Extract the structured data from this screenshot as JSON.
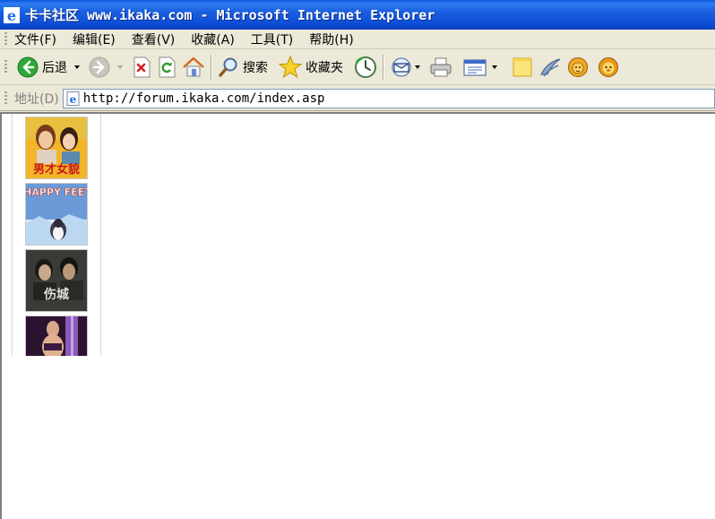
{
  "window": {
    "title": "卡卡社区 www.ikaka.com - Microsoft Internet Explorer"
  },
  "menu": {
    "items": [
      "文件(F)",
      "编辑(E)",
      "查看(V)",
      "收藏(A)",
      "工具(T)",
      "帮助(H)"
    ]
  },
  "toolbar": {
    "back_label": "后退",
    "search_label": "搜索",
    "favorites_label": "收藏夹"
  },
  "address": {
    "label": "地址(D)",
    "url": "http://forum.ikaka.com/index.asp"
  },
  "posters": {
    "items": [
      {
        "name": "poster-1",
        "caption": "男才女貌"
      },
      {
        "name": "poster-2",
        "caption": "HAPPY FEET"
      },
      {
        "name": "poster-3",
        "caption": "伤城"
      },
      {
        "name": "poster-4",
        "caption": ""
      }
    ]
  },
  "colors": {
    "titlebar": "#0c4bd4",
    "chrome": "#ece9d8",
    "address_border": "#7f9db9"
  }
}
